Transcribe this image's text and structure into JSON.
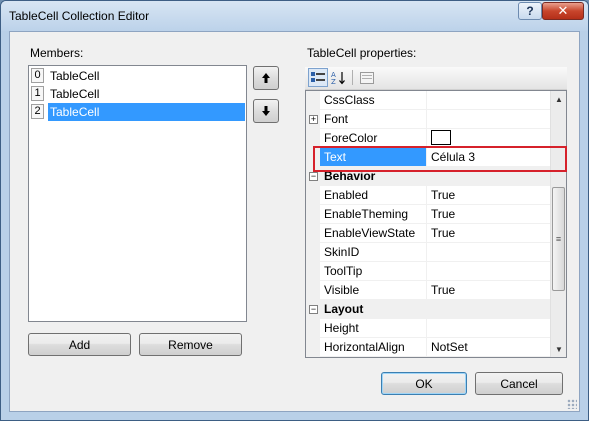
{
  "window": {
    "title": "TableCell Collection Editor",
    "help_label": "?",
    "close_label": "✕"
  },
  "members": {
    "label": "Members:",
    "items": [
      {
        "index": "0",
        "name": "TableCell"
      },
      {
        "index": "1",
        "name": "TableCell"
      },
      {
        "index": "2",
        "name": "TableCell"
      }
    ],
    "selected_index": 2,
    "move_up_icon": "arrow-up-icon",
    "move_down_icon": "arrow-down-icon",
    "add_label": "Add",
    "remove_label": "Remove"
  },
  "properties": {
    "label": "TableCell properties:",
    "toolbar": [
      "categorized-icon",
      "alphabetical-icon",
      "property-pages-icon"
    ],
    "rows": [
      {
        "kind": "prop",
        "name": "CssClass",
        "value": ""
      },
      {
        "kind": "prop",
        "name": "Font",
        "value": "",
        "expander": "+"
      },
      {
        "kind": "prop",
        "name": "ForeColor",
        "value": "",
        "swatch": "#ffffff"
      },
      {
        "kind": "prop",
        "name": "Text",
        "value": "Célula 3",
        "selected": true
      },
      {
        "kind": "cat",
        "name": "Behavior"
      },
      {
        "kind": "prop",
        "name": "Enabled",
        "value": "True"
      },
      {
        "kind": "prop",
        "name": "EnableTheming",
        "value": "True"
      },
      {
        "kind": "prop",
        "name": "EnableViewState",
        "value": "True"
      },
      {
        "kind": "prop",
        "name": "SkinID",
        "value": ""
      },
      {
        "kind": "prop",
        "name": "ToolTip",
        "value": ""
      },
      {
        "kind": "prop",
        "name": "Visible",
        "value": "True"
      },
      {
        "kind": "cat",
        "name": "Layout"
      },
      {
        "kind": "prop",
        "name": "Height",
        "value": ""
      },
      {
        "kind": "prop",
        "name": "HorizontalAlign",
        "value": "NotSet"
      }
    ],
    "scroll_up": "▲",
    "scroll_down": "▼",
    "highlight_color": "#d6212b"
  },
  "footer": {
    "ok_label": "OK",
    "cancel_label": "Cancel"
  }
}
